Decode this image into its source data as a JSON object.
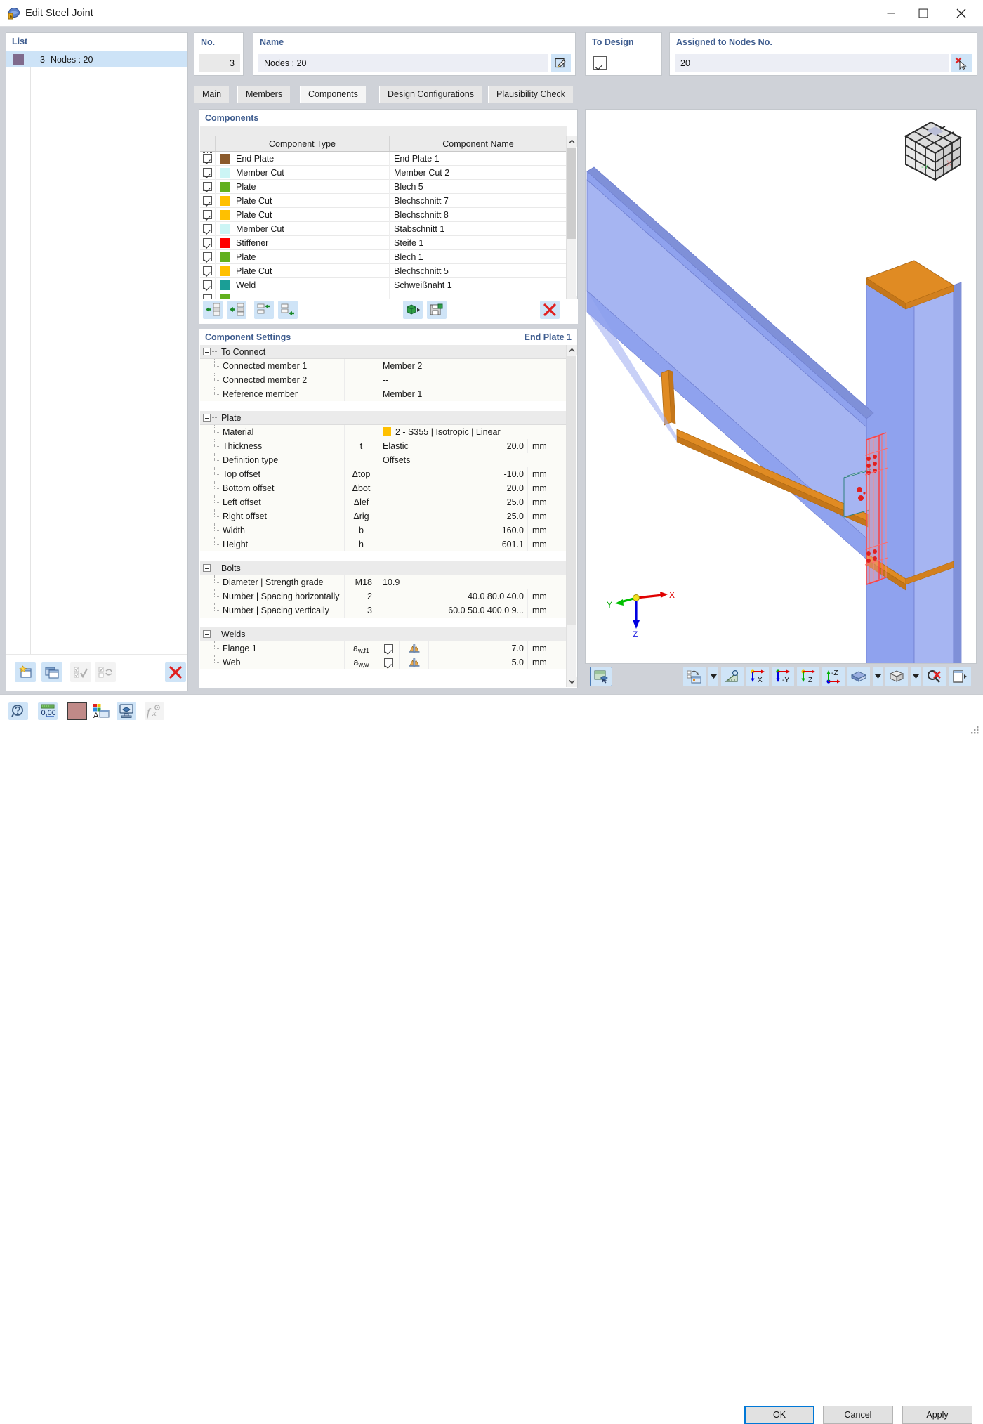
{
  "window": {
    "title": "Edit Steel Joint",
    "app_icon": "steel-joint-icon",
    "minimize": "minimize-icon",
    "maximize": "maximize-icon",
    "close": "close-icon"
  },
  "list_panel": {
    "caption": "List",
    "rows": [
      {
        "number": "3",
        "name": "Nodes : 20",
        "color": "#7f6a8c"
      }
    ],
    "toolbar": [
      {
        "name": "new-joint-button",
        "enabled": true
      },
      {
        "name": "copy-joint-button",
        "enabled": true
      },
      {
        "name": "select-all-button",
        "enabled": false
      },
      {
        "name": "invert-selection-button",
        "enabled": false
      },
      {
        "name": "delete-joint-button",
        "enabled": true
      }
    ]
  },
  "header": {
    "no_label": "No.",
    "no_value": "3",
    "name_label": "Name",
    "name_value": "Nodes : 20",
    "rename_button": "rename-icon",
    "to_design_label": "To Design",
    "to_design_checked": true,
    "assigned_label": "Assigned to Nodes No.",
    "assigned_value": "20",
    "pick_button": "pick-nodes-icon"
  },
  "tabs": [
    {
      "label": "Main",
      "active": false
    },
    {
      "label": "Members",
      "active": false
    },
    {
      "label": "Components",
      "active": true
    },
    {
      "label": "Design Configurations",
      "active": false
    },
    {
      "label": "Plausibility Check",
      "active": false
    }
  ],
  "components_panel": {
    "caption": "Components",
    "columns": [
      "Component Type",
      "Component Name"
    ],
    "rows": [
      {
        "checked": true,
        "color": "#8b5a2b",
        "type": "End Plate",
        "name": "End Plate 1",
        "selected": true
      },
      {
        "checked": true,
        "color": "#ccf5f5",
        "type": "Member Cut",
        "name": "Member Cut 2",
        "selected": false
      },
      {
        "checked": true,
        "color": "#62b01e",
        "type": "Plate",
        "name": "Blech 5",
        "selected": false
      },
      {
        "checked": true,
        "color": "#ffc000",
        "type": "Plate Cut",
        "name": "Blechschnitt 7",
        "selected": false
      },
      {
        "checked": true,
        "color": "#ffc000",
        "type": "Plate Cut",
        "name": "Blechschnitt 8",
        "selected": false
      },
      {
        "checked": true,
        "color": "#ccf5f5",
        "type": "Member Cut",
        "name": "Stabschnitt 1",
        "selected": false
      },
      {
        "checked": true,
        "color": "#ff0000",
        "type": "Stiffener",
        "name": "Steife 1",
        "selected": false
      },
      {
        "checked": true,
        "color": "#62b01e",
        "type": "Plate",
        "name": "Blech 1",
        "selected": false
      },
      {
        "checked": true,
        "color": "#ffc000",
        "type": "Plate Cut",
        "name": "Blechschnitt 5",
        "selected": false
      },
      {
        "checked": true,
        "color": "#1a9e96",
        "type": "Weld",
        "name": "Schweißnaht 1",
        "selected": false
      },
      {
        "checked": false,
        "color": "#62b01e",
        "type": "",
        "name": "",
        "selected": false
      }
    ],
    "toolbar": [
      {
        "name": "insert-component-button"
      },
      {
        "name": "insert-component-above-button"
      },
      {
        "name": "move-component-up-button"
      },
      {
        "name": "move-component-down-button"
      },
      {
        "name": "component-library-button"
      },
      {
        "name": "save-component-template-button"
      },
      {
        "name": "delete-component-button"
      }
    ]
  },
  "settings_panel": {
    "caption": "Component Settings",
    "component": "End Plate 1",
    "groups": [
      {
        "title": "To Connect",
        "rows": [
          {
            "label": "Connected member 1",
            "symbol": "",
            "value": "Member 2",
            "unit": ""
          },
          {
            "label": "Connected member 2",
            "symbol": "",
            "value": "--",
            "unit": ""
          },
          {
            "label": "Reference member",
            "symbol": "",
            "value": "Member 1",
            "unit": ""
          }
        ]
      },
      {
        "title": "Plate",
        "rows": [
          {
            "label": "Material",
            "symbol": "",
            "value": "2 - S355 | Isotropic | Linear Elastic",
            "unit": "",
            "swatch": "#ffc000"
          },
          {
            "label": "Thickness",
            "symbol": "t",
            "value": "20.0",
            "unit": "mm",
            "numeric": true
          },
          {
            "label": "Definition type",
            "symbol": "",
            "value": "Offsets",
            "unit": ""
          },
          {
            "label": "Top offset",
            "symbol": "Δtop",
            "value": "-10.0",
            "unit": "mm",
            "numeric": true
          },
          {
            "label": "Bottom offset",
            "symbol": "Δbot",
            "value": "20.0",
            "unit": "mm",
            "numeric": true
          },
          {
            "label": "Left offset",
            "symbol": "Δlef",
            "value": "25.0",
            "unit": "mm",
            "numeric": true
          },
          {
            "label": "Right offset",
            "symbol": "Δrig",
            "value": "25.0",
            "unit": "mm",
            "numeric": true
          },
          {
            "label": "Width",
            "symbol": "b",
            "value": "160.0",
            "unit": "mm",
            "numeric": true
          },
          {
            "label": "Height",
            "symbol": "h",
            "value": "601.1",
            "unit": "mm",
            "numeric": true
          }
        ]
      },
      {
        "title": "Bolts",
        "rows": [
          {
            "label": "Diameter | Strength grade",
            "symbol": "",
            "mid": "M18",
            "value": "10.9",
            "unit": ""
          },
          {
            "label": "Number | Spacing horizontally",
            "symbol": "",
            "mid": "2",
            "value": "40.0 80.0 40.0",
            "unit": "mm",
            "numeric": true
          },
          {
            "label": "Number | Spacing vertically",
            "symbol": "",
            "mid": "3",
            "value": "60.0 50.0 400.0 9...",
            "unit": "mm",
            "numeric": true
          }
        ]
      },
      {
        "title": "Welds",
        "rows": [
          {
            "label": "Flange 1",
            "symbol": "aw,f1",
            "checked": true,
            "weld_icon": "fillet-weld-icon",
            "value": "7.0",
            "unit": "mm",
            "numeric": true
          },
          {
            "label": "Web",
            "symbol": "aw,w",
            "checked": true,
            "weld_icon": "fillet-weld-icon",
            "value": "5.0",
            "unit": "mm",
            "numeric": true
          }
        ]
      }
    ]
  },
  "viewport": {
    "nav_cube_labels": {
      "x": "X",
      "y": "-Y"
    },
    "axes": {
      "x": "X",
      "y": "Y",
      "z": "Z"
    },
    "colors": {
      "member": "#93a5f0",
      "plate": "#e08b23",
      "highlight": "#ff4040"
    },
    "toolbar": [
      {
        "name": "render-mode-button"
      },
      {
        "name": "display-properties-button"
      },
      {
        "name": "measure-button"
      },
      {
        "name": "view-in-x-button",
        "label": "X"
      },
      {
        "name": "view-in-negative-y-button",
        "label": "-Y"
      },
      {
        "name": "view-in-z-button",
        "label": "Z"
      },
      {
        "name": "view-in-negative-z-button",
        "label": "-Z"
      },
      {
        "name": "render-style-button"
      },
      {
        "name": "view-cube-button"
      },
      {
        "name": "zoom-reset-button"
      },
      {
        "name": "print-view-button"
      }
    ]
  },
  "status_toolbar": [
    {
      "name": "help-button"
    },
    {
      "name": "units-decimals-button"
    },
    {
      "name": "color-swatch-button",
      "color": "#c08a88"
    },
    {
      "name": "display-properties-button"
    },
    {
      "name": "graphic-settings-button"
    },
    {
      "name": "formula-button",
      "enabled": false
    }
  ],
  "dialog_buttons": {
    "ok": "OK",
    "cancel": "Cancel",
    "apply": "Apply"
  }
}
